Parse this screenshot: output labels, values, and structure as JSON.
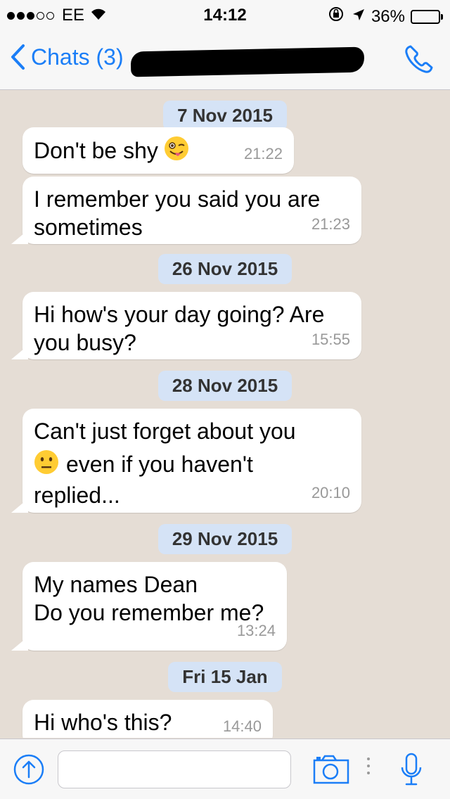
{
  "status_bar": {
    "carrier": "EE",
    "time": "14:12",
    "battery_percent": "36%",
    "battery_level": 0.36
  },
  "nav": {
    "back_label": "Chats (3)",
    "contact_name_redacted": true
  },
  "messages": [
    {
      "type": "date",
      "text": "7 Nov 2015"
    },
    {
      "type": "incoming",
      "text": "Don't be shy",
      "emoji": "winking-face-with-tongue",
      "time": "21:22"
    },
    {
      "type": "incoming",
      "text": "I remember you said you are\nsometimes",
      "time": "21:23"
    },
    {
      "type": "date",
      "text": "26 Nov 2015"
    },
    {
      "type": "incoming",
      "text": "Hi how's your day going? Are\nyou busy?",
      "time": "15:55"
    },
    {
      "type": "date",
      "text": "28 Nov 2015"
    },
    {
      "type": "incoming",
      "text_line1": "Can't just forget about you",
      "emoji": "neutral-face",
      "text_line2": "even if you haven't",
      "text_line3": "replied...",
      "time": "20:10"
    },
    {
      "type": "date",
      "text": "29 Nov 2015"
    },
    {
      "type": "incoming",
      "text": "My names Dean\nDo you remember me?",
      "time": "13:24"
    },
    {
      "type": "date",
      "text": "Fri 15 Jan"
    },
    {
      "type": "incoming",
      "text": "Hi who's this?",
      "time": "14:40"
    }
  ],
  "input": {
    "placeholder": "",
    "value": ""
  },
  "colors": {
    "accent": "#1b7ef7",
    "chat_background": "#e5ddd5",
    "date_badge": "#d5e3f6",
    "bubble": "#ffffff"
  }
}
